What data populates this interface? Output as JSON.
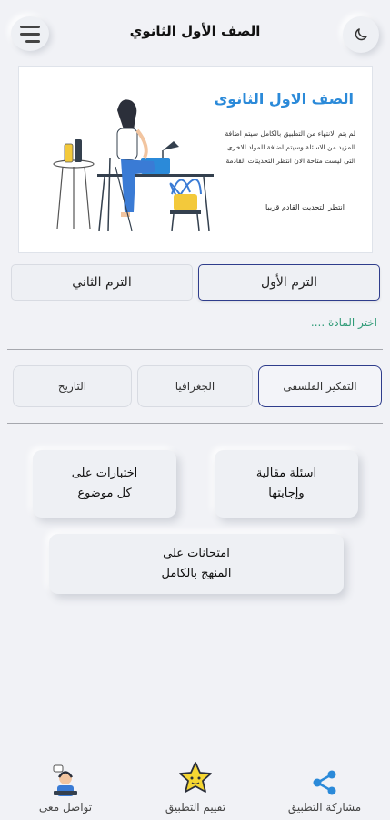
{
  "header": {
    "title": "الصف الأول الثانوي",
    "menu_icon": "hamburger-menu-icon",
    "theme_icon": "moon-icon"
  },
  "banner": {
    "heading": "الصف الاول الثانوى",
    "description": "لم يتم الانتهاء من التطبيق بالكامل سيتم اضافة المزيد من الاسئلة وسيتم اضافة المواد الاخرى التى ليست متاحة الان انتظر التحديثات القادمة",
    "note": "انتظر التحديث القادم قريبا"
  },
  "terms": {
    "first": "الترم الأول",
    "second": "الترم الثاني",
    "active": "first"
  },
  "subjects": {
    "prompt": "اختر المادة ....",
    "items": [
      "التفكير الفلسفى",
      "الجغرافيا",
      "التاريخ"
    ],
    "active_index": 0
  },
  "cards": {
    "essay_questions": "اسئلة مقالية\nوإجابتها",
    "topic_tests": "اختبارات على\nكل موضوع",
    "full_exams": "امتحانات على\nالمنهج بالكامل"
  },
  "bottom_nav": {
    "share": "مشاركة التطبيق",
    "rate": "تقييم التطبيق",
    "contact": "تواصل معى"
  },
  "colors": {
    "accent": "#2f3d8c",
    "banner_heading": "#2b8ad9",
    "prompt": "#2f9b77",
    "background": "#f1f2f6"
  }
}
